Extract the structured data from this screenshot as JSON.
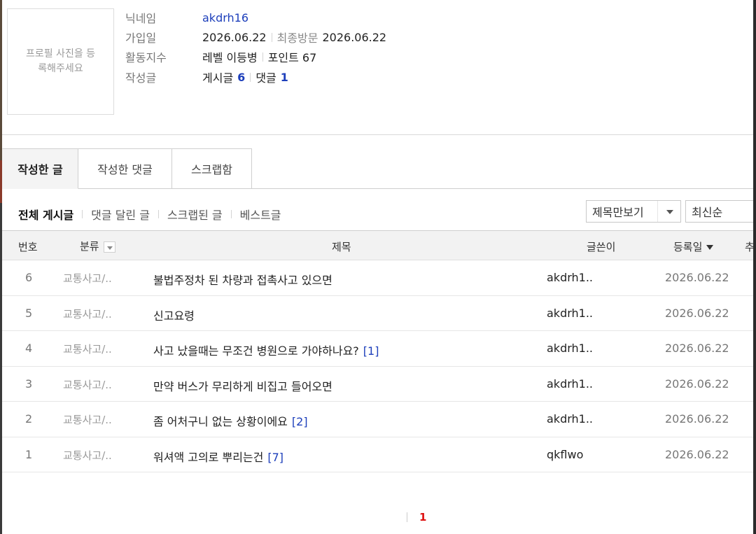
{
  "profile": {
    "photo_placeholder": "프로필 사진을 등록해주세요",
    "nickname_label": "닉네임",
    "nickname": "akdrh16",
    "joined_label": "가입일",
    "joined": "2026.06.22",
    "last_visit_label": "최종방문",
    "last_visit": "2026.06.22",
    "activity_label": "활동지수",
    "level_text": "레벨 이등병",
    "points_text": "포인트 67",
    "posts_label": "작성글",
    "post_count_label": "게시글",
    "post_count": "6",
    "comment_count_label": "댓글",
    "comment_count": "1"
  },
  "tabs": [
    {
      "label": "작성한 글",
      "active": true
    },
    {
      "label": "작성한 댓글",
      "active": false
    },
    {
      "label": "스크랩함",
      "active": false
    }
  ],
  "filters": [
    {
      "label": "전체 게시글",
      "active": true
    },
    {
      "label": "댓글 달린 글",
      "active": false
    },
    {
      "label": "스크랩된 글",
      "active": false
    },
    {
      "label": "베스트글",
      "active": false
    }
  ],
  "view_select": "제목만보기",
  "sort_select": "최신순",
  "table": {
    "headers": {
      "num": "번호",
      "category": "분류",
      "title": "제목",
      "author": "글쓴이",
      "date": "등록일",
      "extra": "추"
    },
    "rows": [
      {
        "num": "6",
        "category": "교통사고/..",
        "title": "불법주정차 된 차량과 접촉사고 있으면",
        "comments": "",
        "author": "akdrh1..",
        "date": "2026.06.22"
      },
      {
        "num": "5",
        "category": "교통사고/..",
        "title": "신고요령",
        "comments": "",
        "author": "akdrh1..",
        "date": "2026.06.22"
      },
      {
        "num": "4",
        "category": "교통사고/..",
        "title": "사고 났을때는 무조건 병원으로 가야하나요?",
        "comments": "[1]",
        "author": "akdrh1..",
        "date": "2026.06.22"
      },
      {
        "num": "3",
        "category": "교통사고/..",
        "title": "만약 버스가 무리하게 비집고 들어오면",
        "comments": "",
        "author": "akdrh1..",
        "date": "2026.06.22"
      },
      {
        "num": "2",
        "category": "교통사고/..",
        "title": "좀 어처구니 없는 상황이에요",
        "comments": "[2]",
        "author": "akdrh1..",
        "date": "2026.06.22"
      },
      {
        "num": "1",
        "category": "교통사고/..",
        "title": "워셔액 고의로 뿌리는건",
        "comments": "[7]",
        "author": "qkflwo",
        "date": "2026.06.22"
      }
    ]
  },
  "pagination": {
    "current": "1"
  }
}
